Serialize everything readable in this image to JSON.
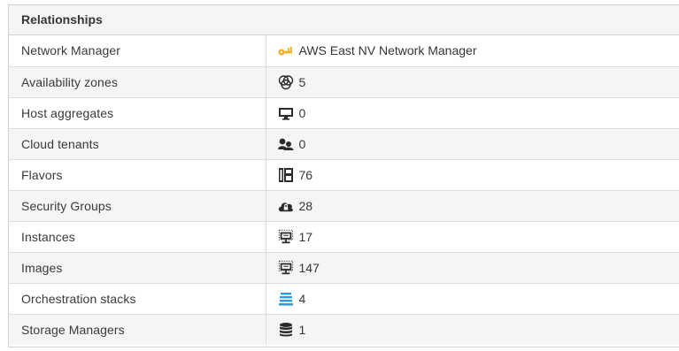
{
  "panel": {
    "title": "Relationships"
  },
  "rows": [
    {
      "label": "Network Manager",
      "value": "AWS East NV Network Manager",
      "icon": "key-icon",
      "link": true
    },
    {
      "label": "Availability zones",
      "value": "5",
      "icon": "availability-zone-icon",
      "link": true
    },
    {
      "label": "Host aggregates",
      "value": "0",
      "icon": "monitor-icon",
      "link": false
    },
    {
      "label": "Cloud tenants",
      "value": "0",
      "icon": "cloud-tenant-icon",
      "link": false
    },
    {
      "label": "Flavors",
      "value": "76",
      "icon": "flavor-icon",
      "link": true
    },
    {
      "label": "Security Groups",
      "value": "28",
      "icon": "cloud-lock-icon",
      "link": true
    },
    {
      "label": "Instances",
      "value": "17",
      "icon": "instance-icon",
      "link": true
    },
    {
      "label": "Images",
      "value": "147",
      "icon": "image-icon",
      "link": true
    },
    {
      "label": "Orchestration stacks",
      "value": "4",
      "icon": "orchestration-stack-icon",
      "link": true
    },
    {
      "label": "Storage Managers",
      "value": "1",
      "icon": "database-icon",
      "link": true
    }
  ],
  "colors": {
    "key": "#f0b323",
    "stack": "#2e9be6",
    "dark": "#2b2b2b"
  }
}
